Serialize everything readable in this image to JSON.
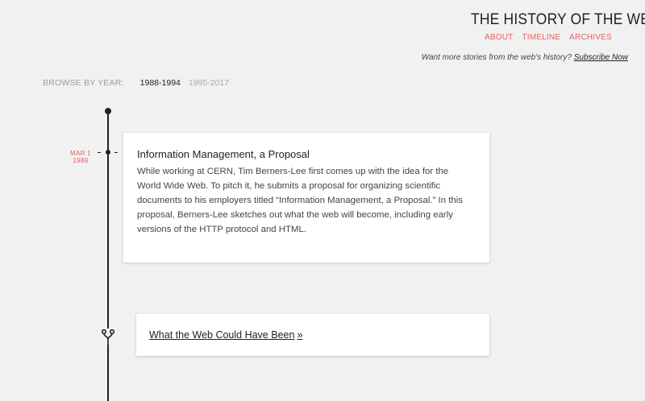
{
  "header": {
    "site_title": "THE HISTORY OF THE WEB",
    "nav": [
      {
        "label": "ABOUT"
      },
      {
        "label": "TIMELINE"
      },
      {
        "label": "ARCHIVES"
      }
    ],
    "subscribe_prompt": "Want more stories from the web's history?",
    "subscribe_link": "Subscribe Now"
  },
  "browse": {
    "label": "BROWSE BY YEAR:",
    "ranges": [
      {
        "label": "1988-1994",
        "active": true
      },
      {
        "label": "1995-2017",
        "active": false
      }
    ]
  },
  "timeline": {
    "entries": [
      {
        "date_month_day": "MAR 1",
        "date_year": "1989",
        "title": "Information Management, a Proposal",
        "body": "While working at CERN, Tim Berners-Lee first comes up with the idea for the World Wide Web. To pitch it, he submits a proposal for organizing scientific documents to his employers titled “Information Management, a Proposal.” In this proposal, Berners-Lee sketches out what the web will become, including early versions of the HTTP protocol and HTML."
      }
    ],
    "story_link": {
      "label": "What the Web Could Have Been",
      "arrow": "»"
    }
  },
  "colors": {
    "accent": "#e8605a",
    "background": "#f1f1f1",
    "card": "#ffffff",
    "line": "#222222"
  },
  "icons": {
    "story_marker": "branch-icon"
  }
}
